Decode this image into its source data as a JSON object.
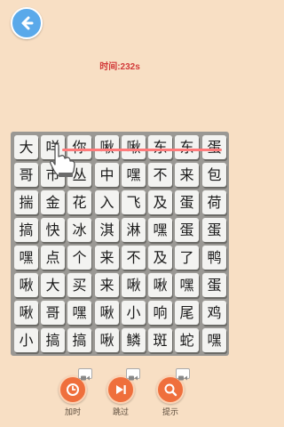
{
  "timer": {
    "text": "时间:232s"
  },
  "board": {
    "rows": [
      [
        "大",
        "咩",
        "你",
        "啾",
        "啾",
        "东",
        "东",
        "蛋"
      ],
      [
        "哥",
        "市",
        "丛",
        "中",
        "嘿",
        "不",
        "来",
        "包"
      ],
      [
        "揣",
        "金",
        "花",
        "入",
        "飞",
        "及",
        "蛋",
        "荷"
      ],
      [
        "搞",
        "快",
        "冰",
        "淇",
        "淋",
        "嘿",
        "蛋",
        "蛋"
      ],
      [
        "嘿",
        "点",
        "个",
        "来",
        "不",
        "及",
        "了",
        "鸭"
      ],
      [
        "啾",
        "大",
        "买",
        "来",
        "啾",
        "啾",
        "嘿",
        "蛋"
      ],
      [
        "啾",
        "哥",
        "嘿",
        "啾",
        "小",
        "响",
        "尾",
        "鸡"
      ],
      [
        "小",
        "搞",
        "搞",
        "啾",
        "鳞",
        "斑",
        "蛇",
        "嘿"
      ]
    ]
  },
  "actions": [
    {
      "label": "加时",
      "icon": "clock-icon"
    },
    {
      "label": "跳过",
      "icon": "skip-icon"
    },
    {
      "label": "提示",
      "icon": "magnifier-icon"
    }
  ],
  "icons": {
    "back": "back-arrow-icon",
    "hand": "pointing-hand-icon",
    "video": "video-ad-icon"
  },
  "colors": {
    "background": "#f8dfc4",
    "timer": "#d23a3a",
    "board": "#9a9894",
    "tile": "#f3f3f1",
    "action": "#ef6f3c",
    "back_button": "#5aa9ea",
    "swipe_line": "#ff7b7b"
  }
}
